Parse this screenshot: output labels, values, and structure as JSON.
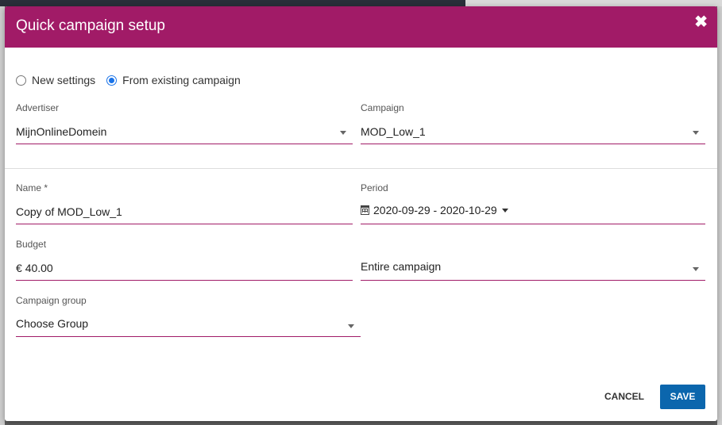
{
  "dialog": {
    "title": "Quick campaign setup",
    "close_icon": "close-icon"
  },
  "mode": {
    "options": [
      {
        "label": "New settings",
        "selected": false
      },
      {
        "label": "From existing campaign",
        "selected": true
      }
    ]
  },
  "advertiser": {
    "label": "Advertiser",
    "value": "MijnOnlineDomein"
  },
  "campaign": {
    "label": "Campaign",
    "value": "MOD_Low_1"
  },
  "name": {
    "label": "Name *",
    "value": "Copy of MOD_Low_1"
  },
  "period": {
    "label": "Period",
    "value": "2020-09-29 - 2020-10-29",
    "icon": "calendar-icon"
  },
  "budget": {
    "label": "Budget",
    "currency": "€",
    "value": "40.00"
  },
  "budget_scope": {
    "value": "Entire campaign"
  },
  "campaign_group": {
    "label": "Campaign group",
    "value": "Choose Group"
  },
  "actions": {
    "cancel_label": "CANCEL",
    "save_label": "SAVE"
  },
  "colors": {
    "header": "#a11b67",
    "accent_underline": "#a11b67",
    "primary_button": "#0b66ad",
    "radio_selected": "#1a73e8"
  }
}
